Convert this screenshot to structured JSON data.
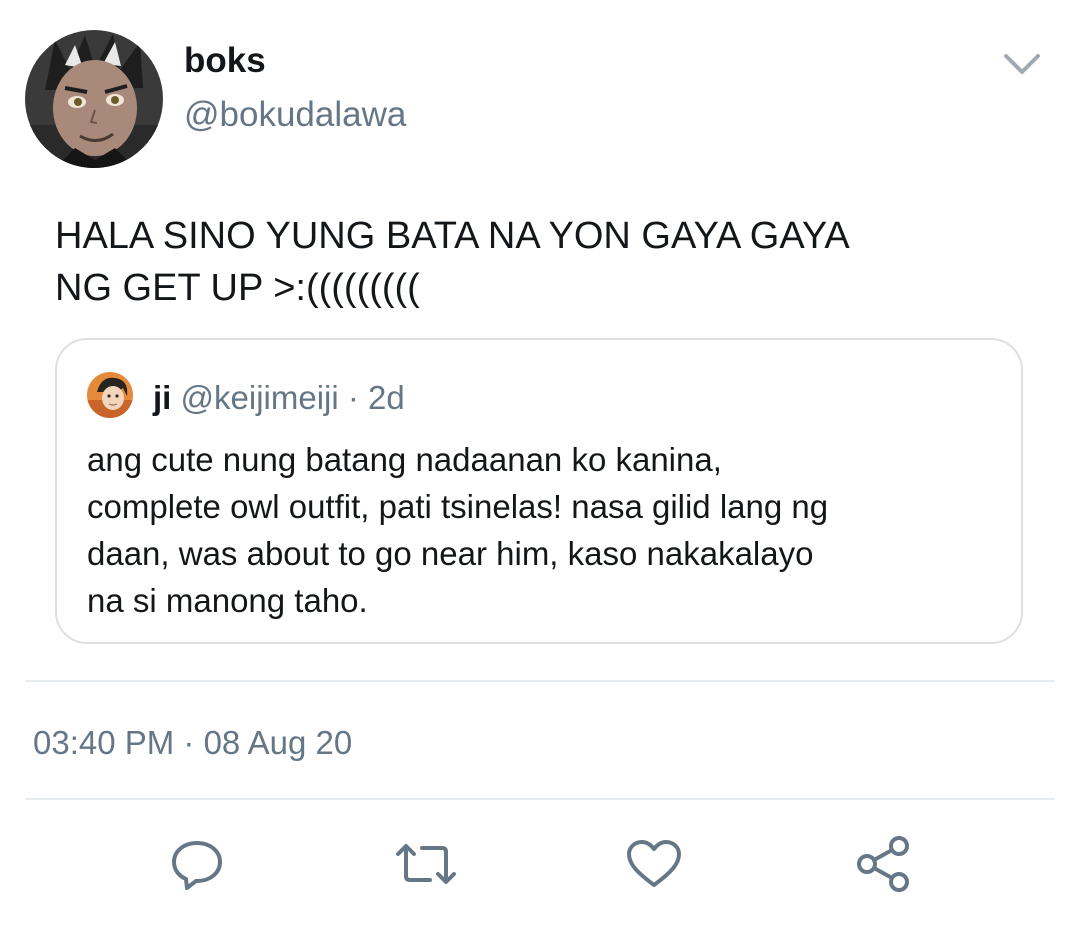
{
  "tweet": {
    "author": {
      "display_name": "boks",
      "handle": "@bokudalawa",
      "avatar": "avatar-anime-character"
    },
    "more_icon": "chevron-down-icon",
    "text": "HALA SINO YUNG BATA NA YON GAYA GAYA\nNG GET UP >:(((((((((",
    "quoted_tweet": {
      "display_name": "ji",
      "handle": "@keijimeiji",
      "separator": "·",
      "time": "2d",
      "avatar": "avatar-anime-character",
      "text": "ang cute nung batang nadaanan ko kanina,\ncomplete owl outfit, pati tsinelas! nasa gilid lang ng\ndaan, was about to go near him, kaso nakakalayo\nna si manong taho."
    },
    "timestamp": "03:40 PM · 08 Aug 20",
    "actions": {
      "reply_icon": "reply-icon",
      "retweet_icon": "retweet-icon",
      "like_icon": "heart-icon",
      "share_icon": "share-icon"
    }
  },
  "colors": {
    "text_primary": "#14171a",
    "text_secondary": "#657786",
    "border": "#dcdfe3",
    "icon": "#657786"
  }
}
